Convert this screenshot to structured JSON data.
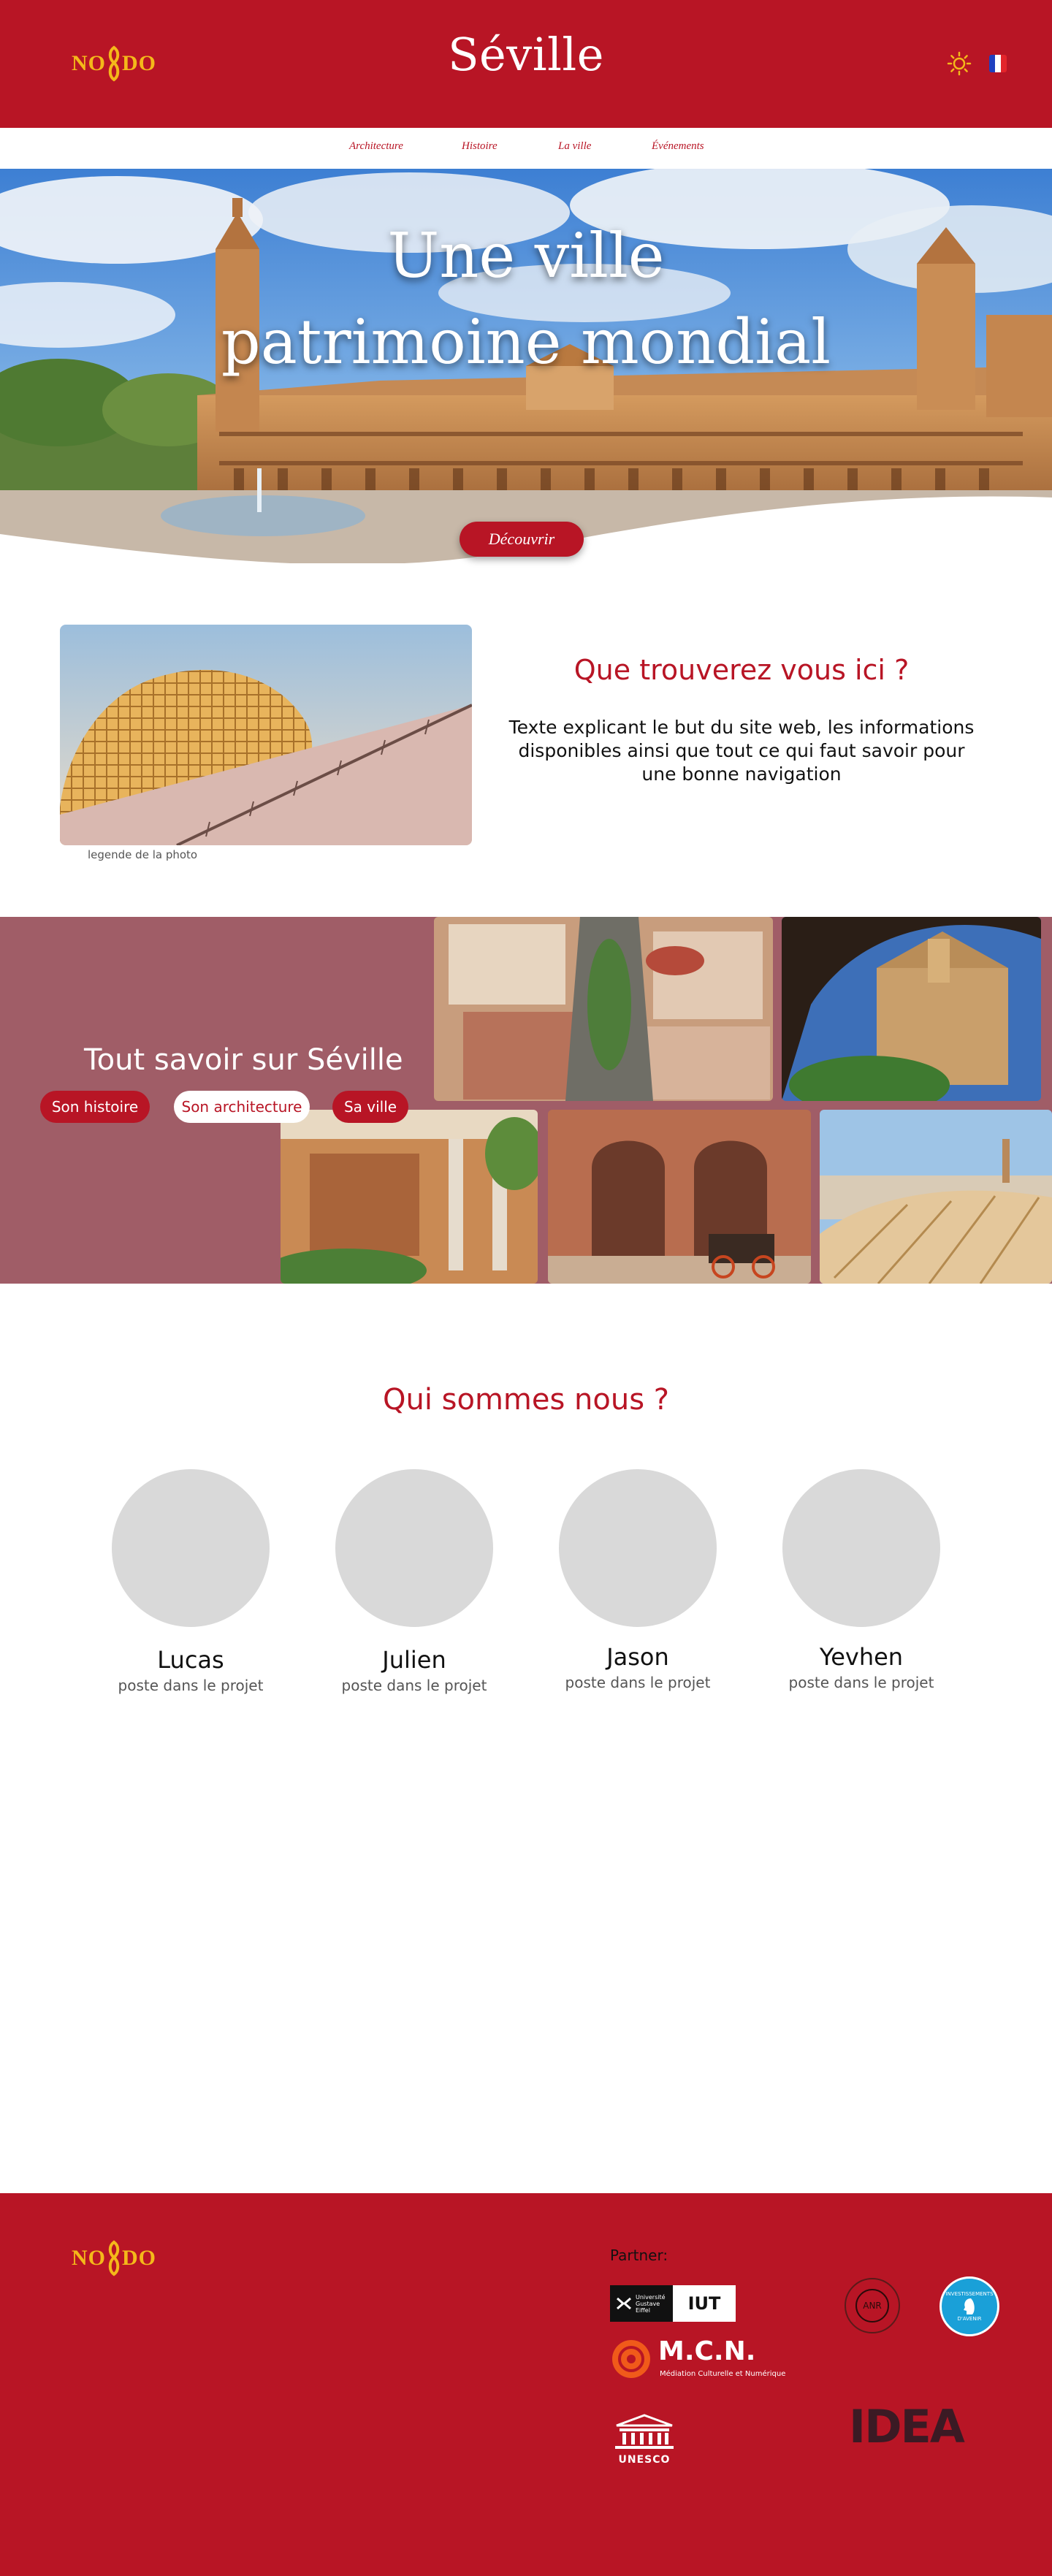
{
  "brand": {
    "logo_text_left": "NO",
    "logo_text_right": "DO"
  },
  "header": {
    "title": "Séville"
  },
  "nav": {
    "items": [
      "Architecture",
      "Histoire",
      "La ville",
      "Événements"
    ]
  },
  "hero": {
    "title_line1": "Une ville",
    "title_line2": "patrimoine mondial",
    "button_label": "Découvrir"
  },
  "info": {
    "heading": "Que trouverez vous ici ?",
    "text": "Texte  explicant le but du site web, les informations disponibles ainsi que tout ce qui faut savoir pour une bonne navigation",
    "photo_caption": "legende de la photo"
  },
  "explore": {
    "title": "Tout savoir sur Séville",
    "pills": [
      "Son histoire",
      "Son architecture",
      "Sa ville"
    ]
  },
  "team": {
    "heading": "Qui sommes nous ?",
    "members": [
      {
        "name": "Lucas",
        "role": "poste dans le projet"
      },
      {
        "name": "Julien",
        "role": "poste dans le projet"
      },
      {
        "name": "Jason",
        "role": "poste dans le projet"
      },
      {
        "name": "Yevhen",
        "role": "poste dans le projet"
      }
    ]
  },
  "footer": {
    "partner_label": "Partner:",
    "partners": {
      "univ_line1": "Université",
      "univ_line2": "Gustave",
      "univ_line3": "Eiffel",
      "iut": "IUT",
      "anr": "ANR",
      "pia_line1": "INVESTISSEMENTS",
      "pia_line2": "D'AVENIR",
      "mcn_title": "M.C.N.",
      "mcn_subtitle": "Médiation Culturelle et Numérique",
      "unesco": "UNESCO",
      "idea": "IDEA"
    }
  },
  "colors": {
    "primary": "#b81525",
    "logo_gold": "#f4b81a",
    "band": "#a05d67",
    "avatar": "#d9d9d9"
  }
}
